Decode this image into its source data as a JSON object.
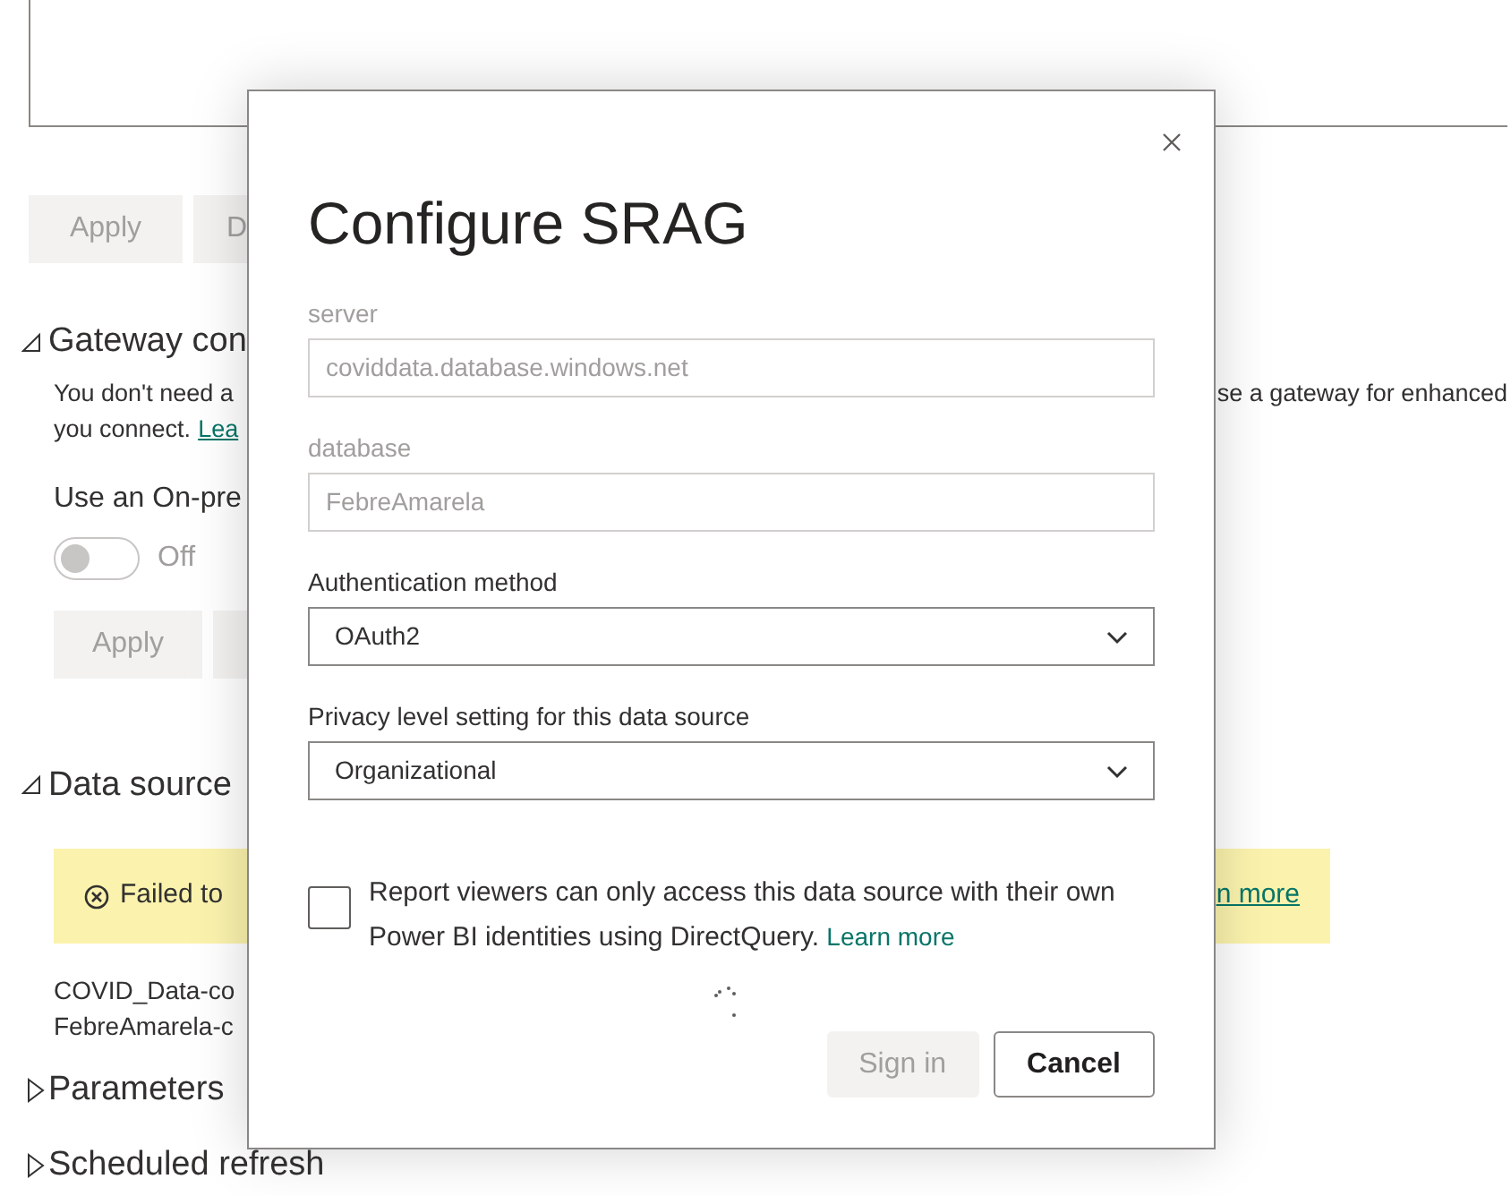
{
  "background": {
    "top_buttons": [
      {
        "label": "Apply",
        "disabled": true
      },
      {
        "label": "D",
        "disabled": true
      }
    ],
    "gateway_section": {
      "heading": "Gateway con",
      "expanded": true,
      "description_left": "You don't need a",
      "description_right": "se a gateway for enhanced",
      "description_line2": "you connect.",
      "link": "Lea",
      "toggle_label": "Use an On-pre",
      "toggle": {
        "on": false,
        "label": "Off"
      },
      "buttons": [
        {
          "label": "Apply",
          "disabled": true
        },
        {
          "disabled": true
        }
      ]
    },
    "data_source_section": {
      "heading": "Data source",
      "expanded": true,
      "banner": {
        "text": "Failed to",
        "link": "n more"
      },
      "items": [
        "COVID_Data-co",
        "FebreAmarela-c"
      ]
    },
    "collapsed_sections": [
      {
        "heading": "Parameters",
        "expanded": false
      },
      {
        "heading": "Scheduled refresh",
        "expanded": false
      }
    ]
  },
  "dialog": {
    "title": "Configure SRAG",
    "fields": [
      {
        "kind": "input",
        "label": "server",
        "value": "coviddata.database.windows.net",
        "disabled": true
      },
      {
        "kind": "input",
        "label": "database",
        "value": "FebreAmarela",
        "disabled": true
      },
      {
        "kind": "select",
        "label": "Authentication method",
        "value": "OAuth2",
        "disabled": false
      },
      {
        "kind": "select",
        "label": "Privacy level setting for this data source",
        "value": "Organizational",
        "disabled": false
      }
    ],
    "checkbox": {
      "checked": false,
      "text": "Report viewers can only access this data source with their own Power BI identities using DirectQuery.",
      "link": "Learn more"
    },
    "loading": true,
    "buttons": [
      {
        "label": "Sign in",
        "kind": "primary",
        "disabled": true
      },
      {
        "label": "Cancel",
        "kind": "secondary",
        "disabled": false
      }
    ]
  }
}
